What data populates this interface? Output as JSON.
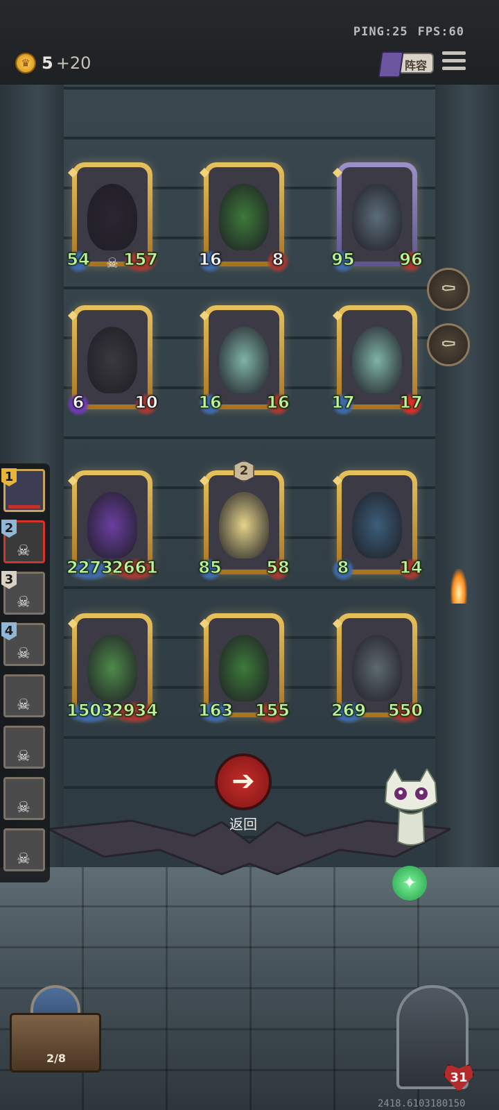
{
  "status": {
    "ping": "PING:25",
    "fps": "FPS:60"
  },
  "currency": {
    "gold": "5",
    "income": "+20",
    "icon": "crown-coin-icon"
  },
  "header": {
    "lineup_label": "阵容",
    "menu_icon": "hamburger-menu-icon"
  },
  "board": {
    "rows": [
      [
        {
          "name": "dark-dragon",
          "atk": "54",
          "hp": "157",
          "skull": true,
          "frame": "gold"
        },
        {
          "name": "green-dragon",
          "atk": "16",
          "hp": "8",
          "frame": "gold",
          "atk_white": true,
          "hp_white": true
        },
        {
          "name": "vampire-bat",
          "atk": "95",
          "hp": "96",
          "frame": "purple"
        }
      ],
      [
        {
          "name": "shadow-drake",
          "atk": "6",
          "hp": "10",
          "frame": "gold",
          "atk_white": true,
          "hp_white": true,
          "atk_style": "purple"
        },
        {
          "name": "sky-dragon",
          "atk": "16",
          "hp": "16",
          "frame": "gold"
        },
        {
          "name": "sky-dragon-2",
          "atk": "17",
          "hp": "17",
          "frame": "gold",
          "hp_style": "spiky"
        }
      ],
      [
        {
          "name": "elf-sorceress",
          "atk": "2273",
          "hp": "2661",
          "frame": "gold"
        },
        {
          "name": "sleeping-princess",
          "atk": "85",
          "hp": "58",
          "frame": "gold",
          "level": "2"
        },
        {
          "name": "dark-elf-queen",
          "atk": "8",
          "hp": "14",
          "frame": "gold"
        }
      ],
      [
        {
          "name": "forest-fairy",
          "atk": "1503",
          "hp": "2934",
          "frame": "gold"
        },
        {
          "name": "green-dragon-2",
          "atk": "163",
          "hp": "155",
          "frame": "gold"
        },
        {
          "name": "mushroom-spider",
          "atk": "269",
          "hp": "550",
          "frame": "gold"
        }
      ]
    ]
  },
  "side_buttons": [
    "coffin-sell-icon",
    "coffin-upgrade-icon"
  ],
  "opponents": [
    {
      "rank": "1",
      "self": true
    },
    {
      "rank": "2",
      "selected": true
    },
    {
      "rank": "3"
    },
    {
      "rank": "4"
    },
    {
      "rank": ""
    },
    {
      "rank": ""
    },
    {
      "rank": ""
    },
    {
      "rank": ""
    }
  ],
  "back": {
    "label": "返回",
    "icon": "arrow-left-icon"
  },
  "shop": {
    "count": "2/8"
  },
  "hero": {
    "hp": "31"
  },
  "coords": "2418.6103180150",
  "colors": {
    "gold_frame": "#d3a43a",
    "purple_frame": "#8177b3",
    "back_red": "#b42323",
    "stat_green": "#bff49b"
  }
}
